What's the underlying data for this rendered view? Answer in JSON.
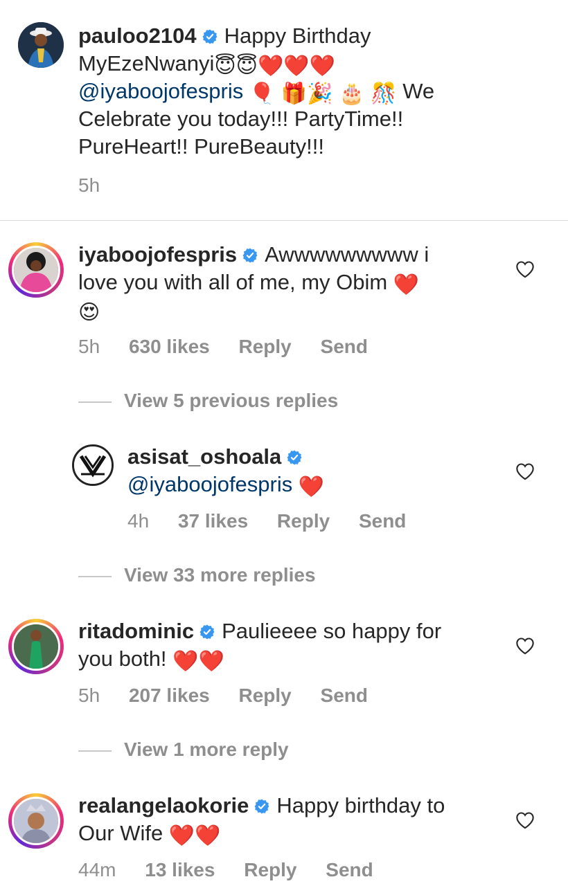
{
  "comments": [
    {
      "username": "pauloo2104",
      "text_parts": [
        "Happy Birthday",
        "MyEzeNwanyi",
        "@iyaboojofespris",
        "We",
        "Celebrate you today!!! PartyTime!!",
        "PureHeart!! PureBeauty!!!"
      ],
      "emojis_line1": [
        "😇",
        "😇",
        "❤️",
        "❤️",
        "❤️"
      ],
      "emojis_line2": [
        "🎈",
        "🎁",
        "🎉",
        "🎂",
        "🎊"
      ],
      "time": "5h"
    },
    {
      "username": "iyaboojofespris",
      "text": "Awwwwwwwww i",
      "text2": "love you with all of me, my Obim",
      "emojis": [
        "❤️",
        "😍"
      ],
      "time": "5h",
      "likes": "630 likes",
      "reply": "Reply",
      "send": "Send"
    },
    {
      "view_replies": "View 5 previous replies"
    },
    {
      "username": "asisat_oshoala",
      "mention": "@iyaboojofespris",
      "emojis": [
        "❤️"
      ],
      "time": "4h",
      "likes": "37 likes",
      "reply": "Reply",
      "send": "Send"
    },
    {
      "view_replies": "View 33 more replies"
    },
    {
      "username": "ritadominic",
      "text": "Paulieeee so happy for",
      "text2": "you both!",
      "emojis": [
        "❤️",
        "❤️"
      ],
      "time": "5h",
      "likes": "207 likes",
      "reply": "Reply",
      "send": "Send"
    },
    {
      "view_replies": "View 1 more reply"
    },
    {
      "username": "realangelaokorie",
      "text": "Happy birthday to",
      "text2": "Our Wife",
      "emojis": [
        "❤️",
        "❤️"
      ],
      "time": "44m",
      "likes": "13 likes",
      "reply": "Reply",
      "send": "Send"
    }
  ],
  "colors": {
    "text": "#262626",
    "muted": "#8e8e8e",
    "mention": "#00376b",
    "verified": "#3897f0",
    "heart": "#e0245e"
  }
}
